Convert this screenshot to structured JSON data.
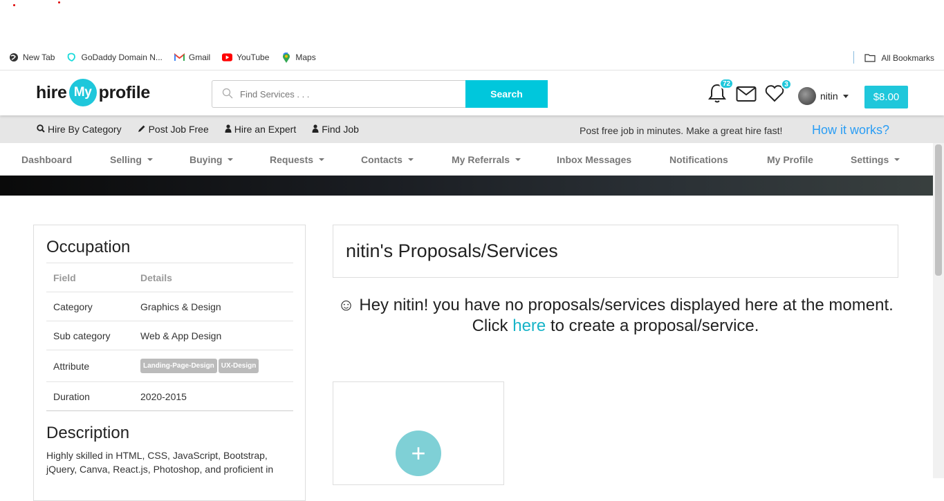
{
  "bookmarks": {
    "items": [
      {
        "label": "New Tab",
        "icon": "globe-icon"
      },
      {
        "label": "GoDaddy Domain N...",
        "icon": "godaddy-icon"
      },
      {
        "label": "Gmail",
        "icon": "gmail-icon"
      },
      {
        "label": "YouTube",
        "icon": "youtube-icon"
      },
      {
        "label": "Maps",
        "icon": "maps-icon"
      }
    ],
    "all_label": "All Bookmarks"
  },
  "header": {
    "logo_left": "hire",
    "logo_mid": "My",
    "logo_right": "profile",
    "search_placeholder": "Find Services . . .",
    "search_button": "Search",
    "notifications_count": "72",
    "favorites_count": "3",
    "username": "nitin",
    "balance": "$8.00"
  },
  "subnav": {
    "links": [
      "Hire By Category",
      "Post Job Free",
      "Hire an Expert",
      "Find Job"
    ],
    "tagline": "Post free job in minutes. Make a great hire fast!",
    "how_it_works": "How it works?"
  },
  "dashboard_menu": [
    "Dashboard",
    "Selling",
    "Buying",
    "Requests",
    "Contacts",
    "My Referrals",
    "Inbox Messages",
    "Notifications",
    "My Profile",
    "Settings"
  ],
  "occupation": {
    "title": "Occupation",
    "headers": [
      "Field",
      "Details"
    ],
    "rows": [
      {
        "field": "Category",
        "value": "Graphics & Design"
      },
      {
        "field": "Sub category",
        "value": "Web & App Design"
      },
      {
        "field": "Attribute",
        "tags": [
          "Landing-Page-Design",
          "UX-Design"
        ]
      },
      {
        "field": "Duration",
        "value": "2020-2015"
      }
    ]
  },
  "description": {
    "title": "Description",
    "text": "Highly skilled in HTML, CSS, JavaScript, Bootstrap, jQuery, Canva, React.js, Photoshop, and proficient in"
  },
  "proposals": {
    "title": "nitin's Proposals/Services",
    "message_before": "☺ Hey nitin! you have no proposals/services displayed here at the moment. Click ",
    "message_link": "here",
    "message_after": " to create a proposal/service.",
    "plus": "+"
  },
  "colors": {
    "accent": "#1fc7db",
    "link": "#2a9df4"
  }
}
